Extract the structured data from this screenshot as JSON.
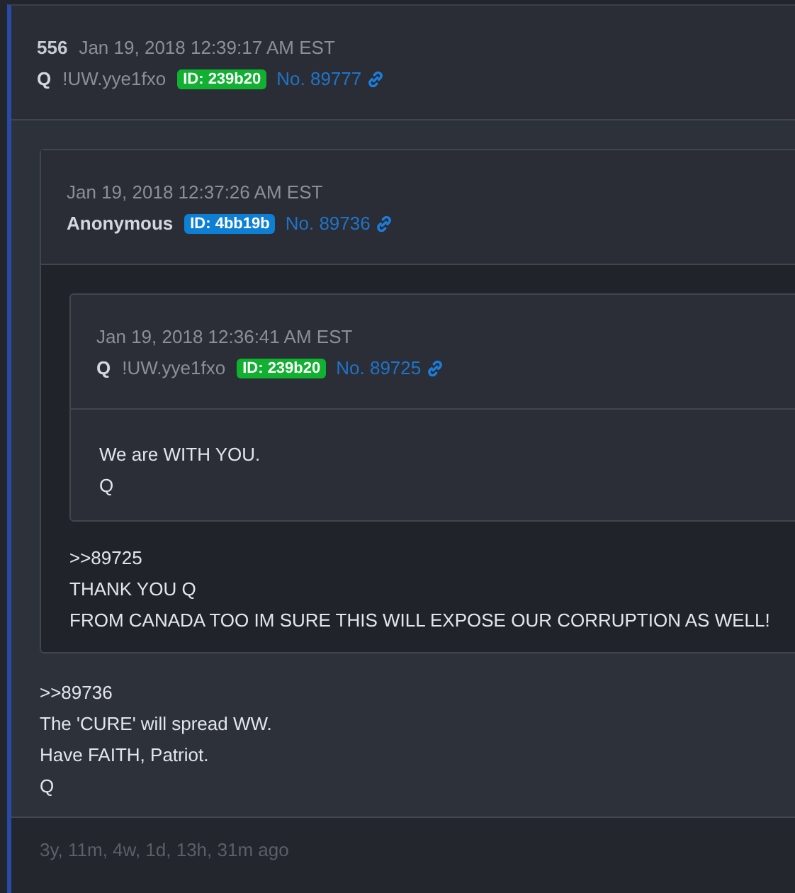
{
  "post": {
    "number": "556",
    "date": "Jan 19, 2018 12:39:17 AM EST",
    "author": "Q",
    "tripcode": "!UW.yye1fxo",
    "id": {
      "text": "ID: 239b20",
      "color": "#10b030"
    },
    "post_no": "No. 89777",
    "quote": {
      "date": "Jan 19, 2018 12:37:26 AM EST",
      "author": "Anonymous",
      "id": {
        "text": "ID: 4bb19b",
        "color": "#0d7fd4"
      },
      "post_no": "No. 89736",
      "quote": {
        "date": "Jan 19, 2018 12:36:41 AM EST",
        "author": "Q",
        "tripcode": "!UW.yye1fxo",
        "id": {
          "text": "ID: 239b20",
          "color": "#10b030"
        },
        "post_no": "No. 89725",
        "lines": [
          "We are WITH YOU.",
          "Q"
        ]
      },
      "lines": [
        ">>89725",
        "THANK YOU Q",
        "FROM CANADA TOO IM SURE THIS WILL EXPOSE OUR CORRUPTION AS WELL!"
      ]
    },
    "lines": [
      ">>89736",
      "The 'CURE' will spread WW.",
      "Have FAITH, Patriot.",
      "Q"
    ],
    "age": "3y, 11m, 4w, 1d, 13h, 31m ago"
  }
}
